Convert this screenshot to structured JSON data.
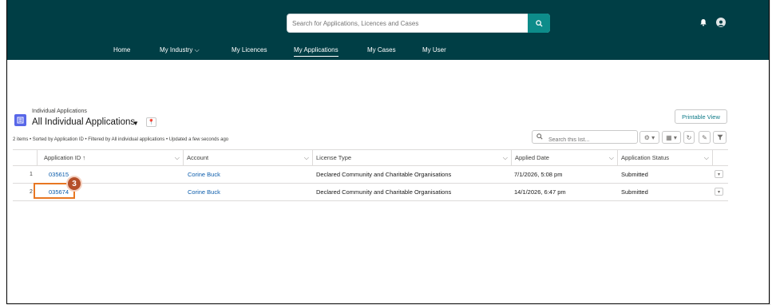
{
  "header": {
    "search_placeholder": "Search for Applications, Licences and Cases",
    "nav": [
      {
        "label": "Home"
      },
      {
        "label": "My Industry"
      },
      {
        "label": "My Licences"
      },
      {
        "label": "My Applications"
      },
      {
        "label": "My Cases"
      },
      {
        "label": "My User"
      }
    ],
    "active_nav": "My Applications"
  },
  "list": {
    "object_label": "Individual Applications",
    "title": "All Individual Applications",
    "printable_view": "Printable View",
    "search_placeholder": "Search this list...",
    "meta": "2 items • Sorted by Application ID • Filtered by All individual applications • Updated a few seconds ago",
    "columns": [
      {
        "label": "Application ID",
        "sort": "↑"
      },
      {
        "label": "Account"
      },
      {
        "label": "License Type"
      },
      {
        "label": "Applied Date"
      },
      {
        "label": "Application Status"
      }
    ],
    "rows": [
      {
        "num": "1",
        "app_id": "035615",
        "account": "Corine Buck",
        "license_type": "Declared Community and Charitable Organisations",
        "applied_date": "7/1/2026, 5:08 pm",
        "status": "Submitted"
      },
      {
        "num": "2",
        "app_id": "035674",
        "account": "Corine Buck",
        "license_type": "Declared Community and Charitable Organisations",
        "applied_date": "14/1/2026, 6:47 pm",
        "status": "Submitted"
      }
    ]
  },
  "annotation": {
    "step_number": "3",
    "highlight_color": "#e87722"
  },
  "colors": {
    "header_bg": "#003e45",
    "search_button": "#0d8c8a",
    "link": "#0b5cab",
    "object_icon": "#5867e8"
  }
}
